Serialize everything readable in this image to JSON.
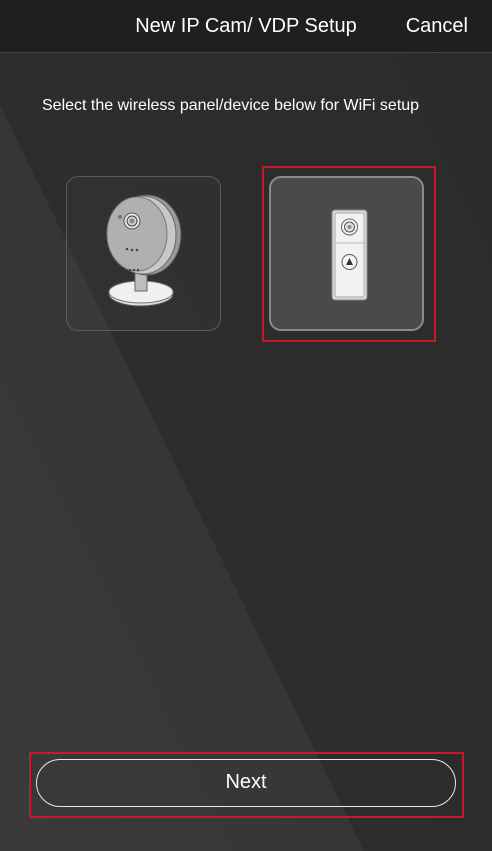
{
  "header": {
    "title": "New IP Cam/ VDP Setup",
    "cancel_label": "Cancel"
  },
  "instruction": "Select the wireless panel/device below for WiFi setup",
  "devices": [
    {
      "icon": "ip-camera-icon",
      "selected": false
    },
    {
      "icon": "video-door-phone-icon",
      "selected": true
    }
  ],
  "footer": {
    "next_label": "Next"
  },
  "colors": {
    "header_bg": "#1f1f1f",
    "background": "#2f2f2f",
    "selection_highlight": "#c8192a",
    "selected_tile_bg": "#4a4a4a"
  }
}
